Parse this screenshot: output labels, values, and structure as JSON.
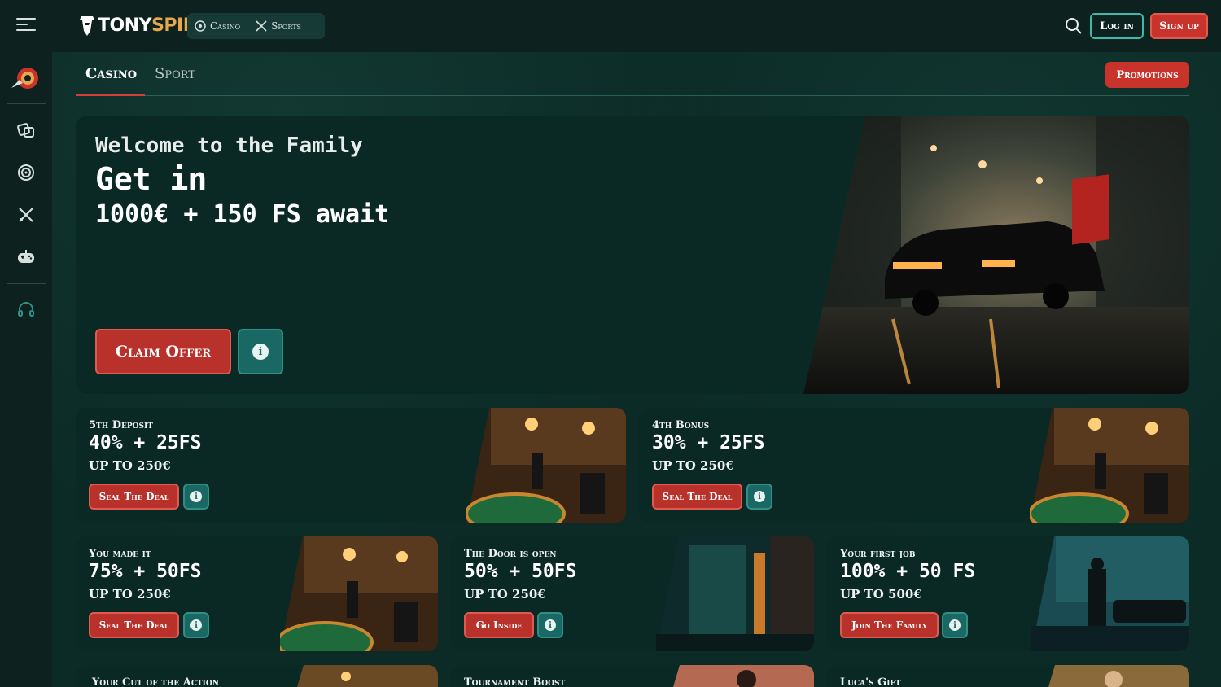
{
  "brand": {
    "name_part1": "TONY",
    "name_part2": "SPINS",
    "accent": "#c8332c",
    "teal": "#1a6863"
  },
  "header": {
    "modes": [
      {
        "label": "Casino",
        "icon": "casino-chip-icon"
      },
      {
        "label": "Sports",
        "icon": "crossed-bats-icon"
      }
    ],
    "login_label": "Log in",
    "signup_label": "Sign up"
  },
  "sidebar": {
    "items": [
      {
        "icon": "roulette-logo-icon"
      },
      {
        "icon": "dice-icon"
      },
      {
        "icon": "target-icon"
      },
      {
        "icon": "sports-icon"
      },
      {
        "icon": "gamepad-icon"
      },
      {
        "icon": "headset-icon"
      }
    ]
  },
  "tabs": [
    {
      "label": "Casino",
      "active": true
    },
    {
      "label": "Sport",
      "active": false
    }
  ],
  "promotions_label": "Promotions",
  "hero": {
    "kicker": "Welcome to the Family",
    "title": "Get in",
    "subtitle": "1000€ + 150 FS await",
    "cta_label": "Claim Offer",
    "image": "black-car-in-foggy-alley"
  },
  "offers": [
    {
      "kicker": "5th Deposit",
      "title": "40% + 25FS",
      "sub": "UP TO 250€",
      "cta": "Seal The Deal",
      "image": "casino-table-room"
    },
    {
      "kicker": "4th Bonus",
      "title": "30% + 25FS",
      "sub": "UP TO 250€",
      "cta": "Seal The Deal",
      "image": "casino-table-room"
    },
    {
      "kicker": "You made it",
      "title": "75% + 50FS",
      "sub": "UP TO 250€",
      "cta": "Seal The Deal",
      "image": "casino-table-room"
    },
    {
      "kicker": "The Door is open",
      "title": "50% + 50FS",
      "sub": "UP TO 250€",
      "cta": "Go Inside",
      "image": "dark-alley-door"
    },
    {
      "kicker": "Your first job",
      "title": "100% + 50 FS",
      "sub": "UP TO 500€",
      "cta": "Join The Family",
      "image": "gangster-and-car"
    },
    {
      "kicker": "Your Cut of the Action",
      "title": "",
      "sub": "",
      "cta": "",
      "image": "casino-room"
    },
    {
      "kicker": "Tournament Boost",
      "title": "",
      "sub": "",
      "cta": "",
      "image": "woman-portrait"
    },
    {
      "kicker": "Luca's Gift",
      "title": "",
      "sub": "",
      "cta": "",
      "image": "man-portrait"
    }
  ]
}
